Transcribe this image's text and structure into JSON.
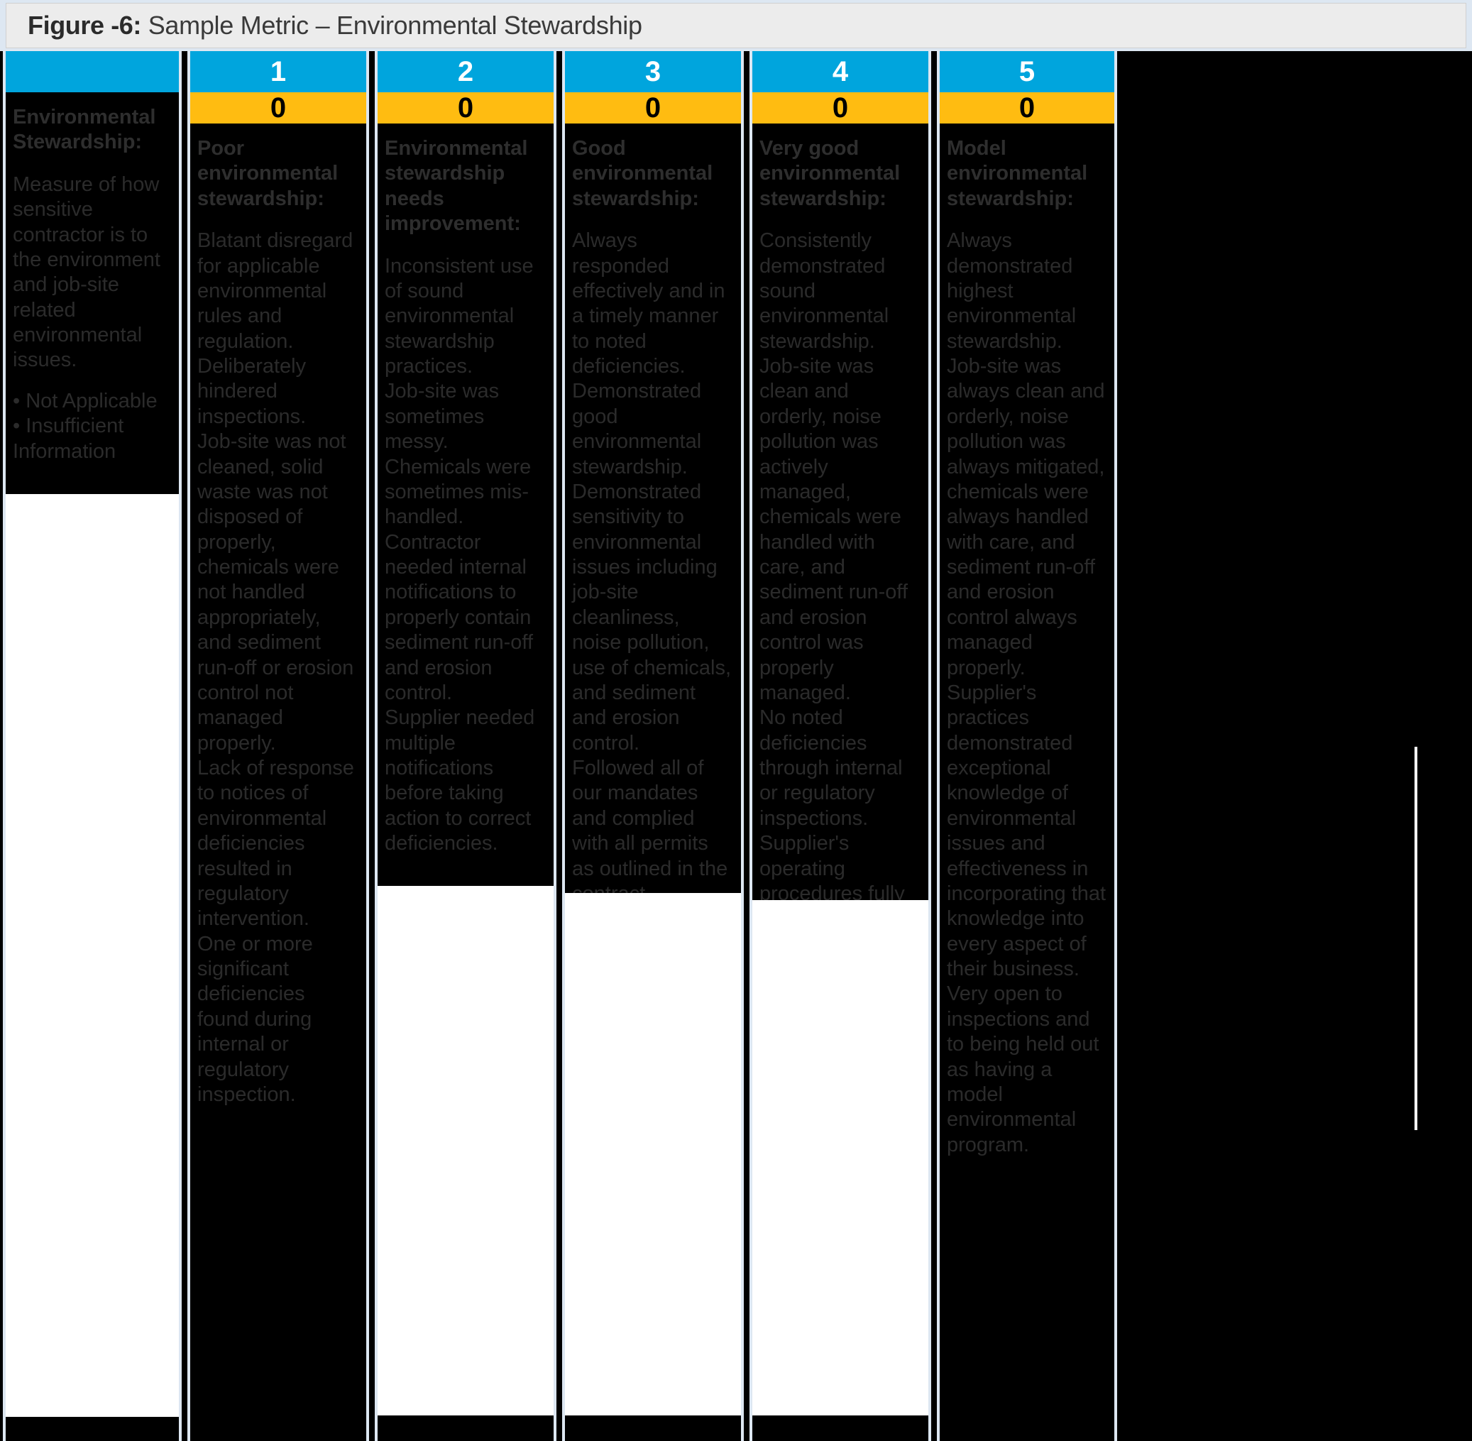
{
  "caption": {
    "figure_label": "Figure -6:",
    "title": " Sample Metric – Environmental Stewardship"
  },
  "colors": {
    "band_number": "#00a5dd",
    "band_score": "#ffbc11",
    "panel_background": "#000000",
    "page_background": "#dde7f2",
    "caption_background": "#ececec",
    "text": "#2b2b2b"
  },
  "columns": [
    {
      "number": "",
      "score": "",
      "heading": "Environmental Stewardship:",
      "body": "Measure of how sensitive contractor is to the environment and job-site related environmental issues.",
      "bullets": [
        "Not Applicable",
        "Insufficient Information"
      ]
    },
    {
      "number": "1",
      "score": "0",
      "heading": "Poor environmental stewardship:",
      "body": "Blatant disregard for applicable environmental rules and regulation.\nDeliberately hindered inspections.\nJob-site was not cleaned, solid waste was not disposed of properly, chemicals were not handled appropriately, and sediment run-off or erosion control not managed properly.\nLack of response to notices of environmental deficiencies resulted in regulatory intervention.\nOne or more significant deficiencies found during internal or regulatory inspection.",
      "bullets": []
    },
    {
      "number": "2",
      "score": "0",
      "heading": "Environmental stewardship needs improvement:",
      "body": "Inconsistent use of sound environmental stewardship practices.\nJob-site was sometimes messy.\nChemicals were sometimes mis-handled.\nContractor needed internal notifications to properly contain sediment run-off and erosion control.\nSupplier needed multiple notifications before taking action to correct deficiencies.",
      "bullets": []
    },
    {
      "number": "3",
      "score": "0",
      "heading": "Good environmental stewardship:",
      "body": "Always responded effectively and in a timely manner to noted deficiencies.\nDemonstrated good environmental stewardship.\nDemonstrated sensitivity to environmental issues including job-site cleanliness, noise pollution, use of chemicals, and sediment and erosion control.\nFollowed all of our mandates and complied with all permits as outlined in the contract.\nSupplier's operating procedures address environmental stewardship.",
      "bullets": []
    },
    {
      "number": "4",
      "score": "0",
      "heading": "Very good environmental stewardship:",
      "body": "Consistently demonstrated sound environmental stewardship.\nJob-site was clean and orderly, noise pollution was actively managed, chemicals were handled with care, and sediment run-off and erosion control was properly managed.\nNo noted deficiencies through internal or regulatory inspections.\nSupplier's operating procedures fully address management of environmental issues.",
      "bullets": []
    },
    {
      "number": "5",
      "score": "0",
      "heading": "Model environmental stewardship:",
      "body": "Always demonstrated highest environmental stewardship.\nJob-site was always clean and orderly, noise pollution was always mitigated, chemicals were always handled with care, and sediment run-off and erosion control always managed properly.\nSupplier's practices demonstrated exceptional knowledge of environmental issues and effectiveness in incorporating that knowledge into every aspect of their business.\nVery open to inspections and to being held out as having a model environmental program.",
      "bullets": []
    }
  ]
}
